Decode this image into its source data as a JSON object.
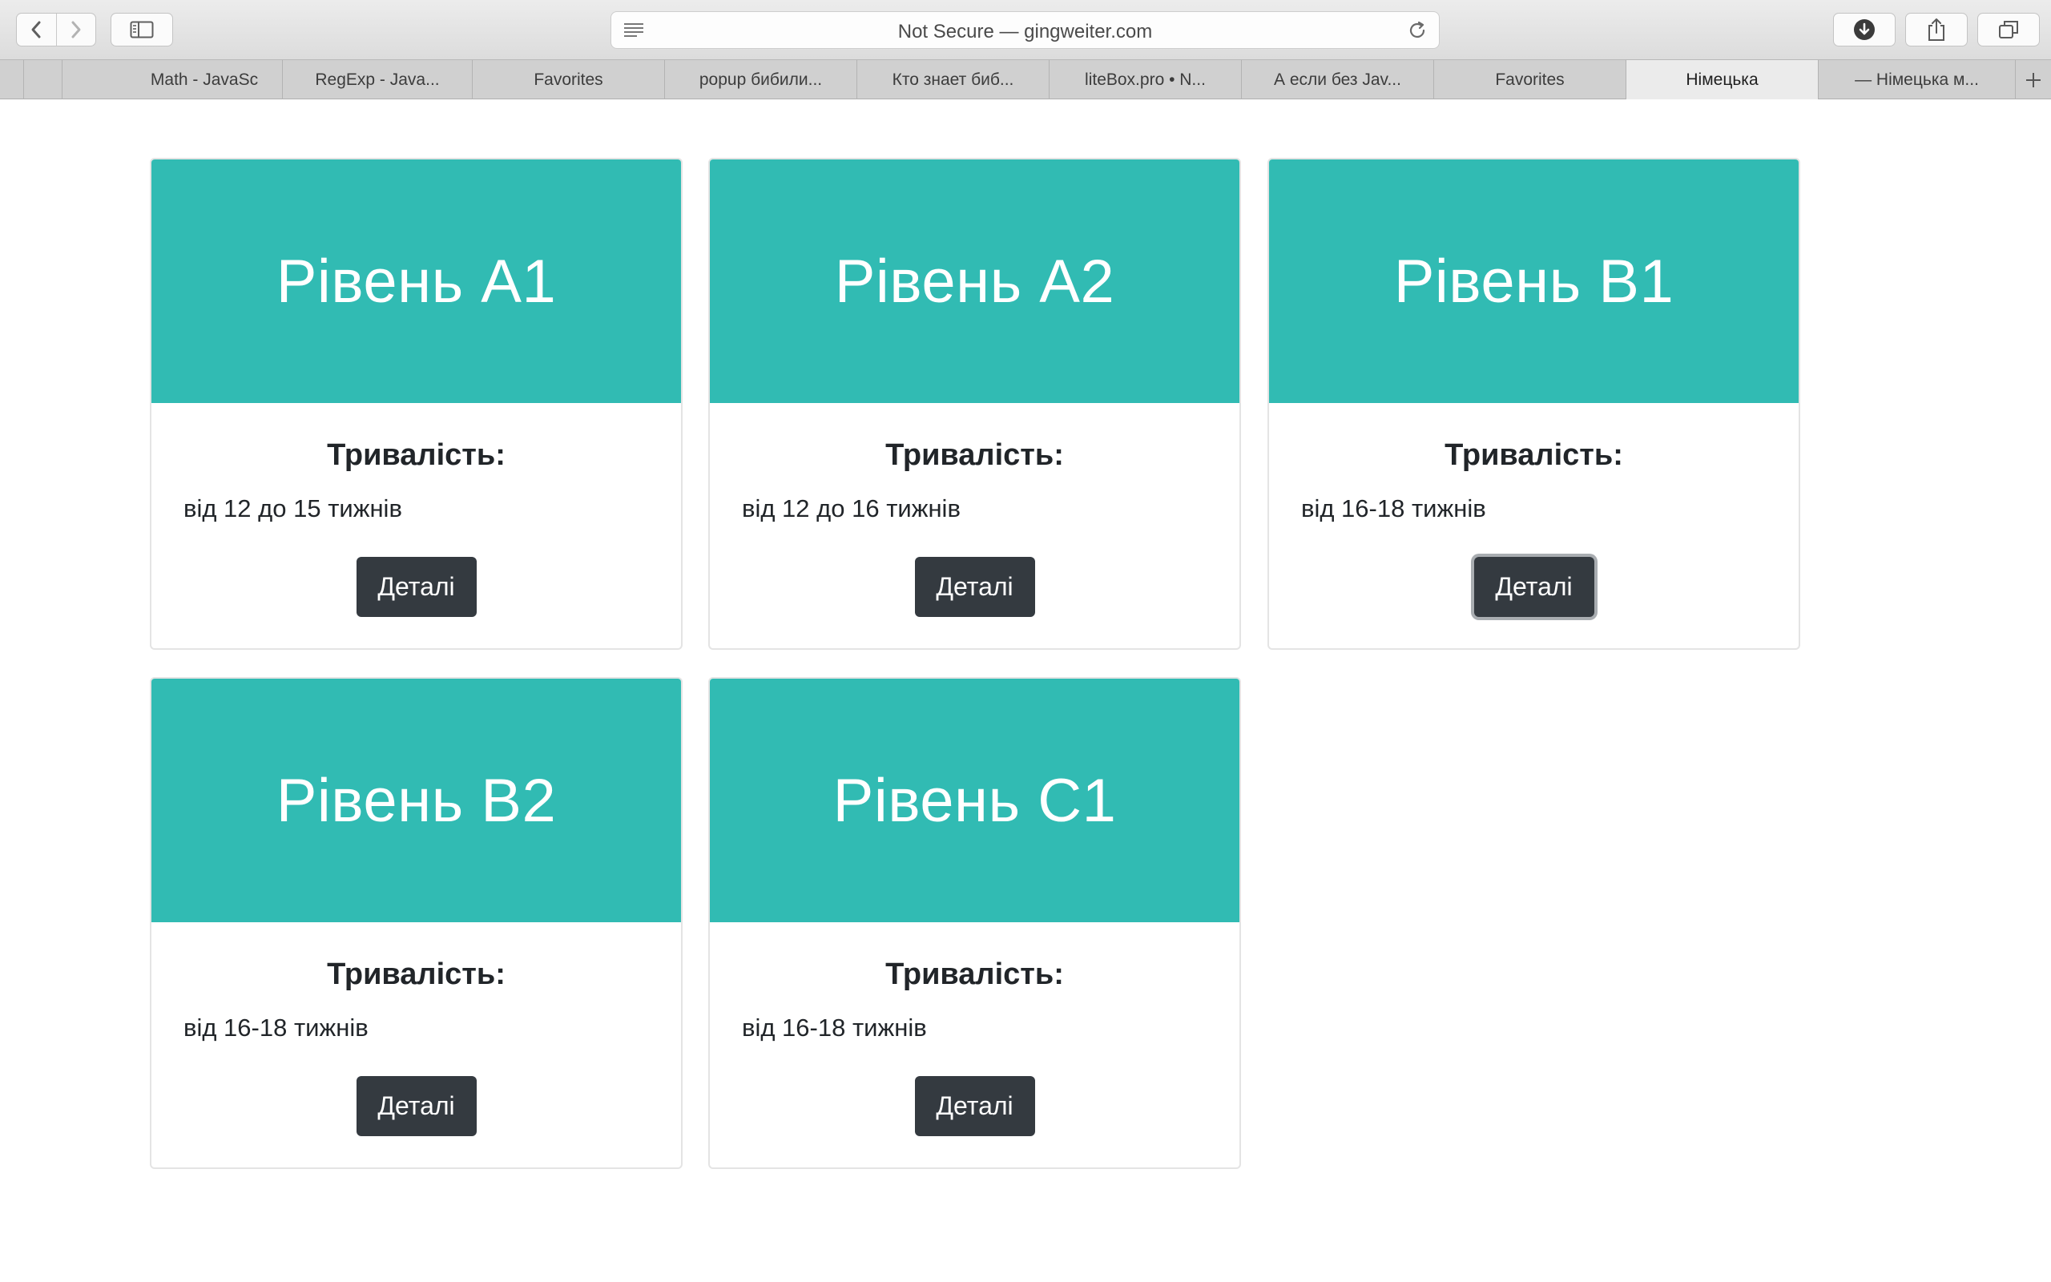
{
  "browser": {
    "address": "Not Secure — gingweiter.com",
    "tabs": [
      {
        "label": "",
        "active": false
      },
      {
        "label": "",
        "active": false
      },
      {
        "label": "Math - JavaSc",
        "active": false
      },
      {
        "label": "RegExp - Java...",
        "active": false
      },
      {
        "label": "Favorites",
        "active": false
      },
      {
        "label": "popup бибили...",
        "active": false
      },
      {
        "label": "Кто знает биб...",
        "active": false
      },
      {
        "label": "liteBox.pro • N...",
        "active": false
      },
      {
        "label": "А если без Jav...",
        "active": false
      },
      {
        "label": "Favorites",
        "active": false
      },
      {
        "label": "Німецька",
        "active": true
      },
      {
        "label": "— Німецька м...",
        "active": false
      }
    ]
  },
  "cards": [
    {
      "title": "Рівень A1",
      "subtitle": "Тривалість:",
      "text": "від 12 до 15 тижнів",
      "button": "Деталі"
    },
    {
      "title": "Рівень A2",
      "subtitle": "Тривалість:",
      "text": "від 12 до 16 тижнів",
      "button": "Деталі"
    },
    {
      "title": "Рівень B1",
      "subtitle": "Тривалість:",
      "text": "від 16-18 тижнів",
      "button": "Деталі"
    },
    {
      "title": "Рівень B2",
      "subtitle": "Тривалість:",
      "text": "від 16-18 тижнів",
      "button": "Деталі"
    },
    {
      "title": "Рівень C1",
      "subtitle": "Тривалість:",
      "text": "від 16-18 тижнів",
      "button": "Деталі"
    }
  ]
}
